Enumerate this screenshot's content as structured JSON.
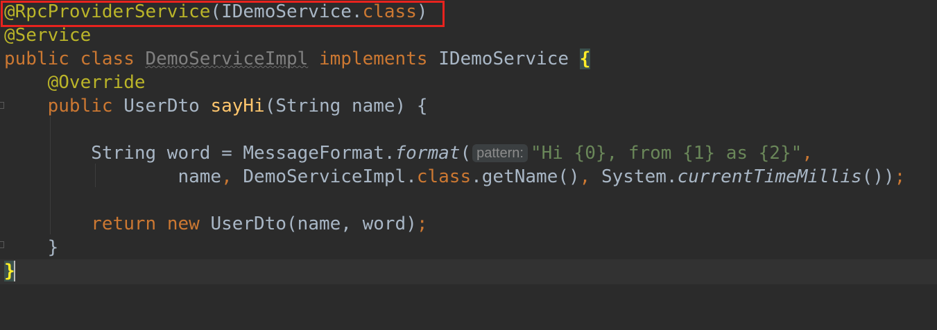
{
  "colors": {
    "background": "#2b2b2b",
    "annotation": "#bbb529",
    "keyword": "#cc7832",
    "method_declaration": "#ffc66d",
    "string": "#6a8759",
    "default_text": "#a9b7c6",
    "highlight_box": "#e8231e"
  },
  "code": {
    "line1": {
      "annotation": "@RpcProviderService",
      "open_paren": "(",
      "argument": "IDemoService.",
      "class_keyword": "class",
      "close_paren": ")"
    },
    "line2": {
      "annotation": "@Service"
    },
    "line3": {
      "kw_public": "public",
      "kw_class": "class",
      "class_name": "DemoServiceImpl",
      "kw_implements": "implements",
      "interface_name": "IDemoService",
      "open_brace": "{"
    },
    "line4": {
      "annotation": "@Override"
    },
    "line5": {
      "kw_public": "public",
      "return_type": "UserDto",
      "method_name": "sayHi",
      "params": "(String name) {"
    },
    "line7": {
      "decl": "String word = MessageFormat.",
      "static_call": "format",
      "open_paren": "(",
      "param_hint": "pattern:",
      "string_literal": "\"Hi {0}, from {1} as {2}\"",
      "comma": ","
    },
    "line8": {
      "args_start": "name",
      "comma1": ",",
      "class_ref": " DemoServiceImpl.",
      "class_keyword": "class",
      "get_name": ".getName()",
      "comma2": ",",
      "system_ref": " System.",
      "static_call": "currentTimeMillis",
      "close": "())",
      "semicolon": ";"
    },
    "line10": {
      "kw_return": "return",
      "kw_new": "new",
      "ctor_call": "UserDto(name, word)",
      "semicolon": ";"
    },
    "line11": {
      "close_brace": "}"
    },
    "line12": {
      "close_brace": "}"
    }
  }
}
